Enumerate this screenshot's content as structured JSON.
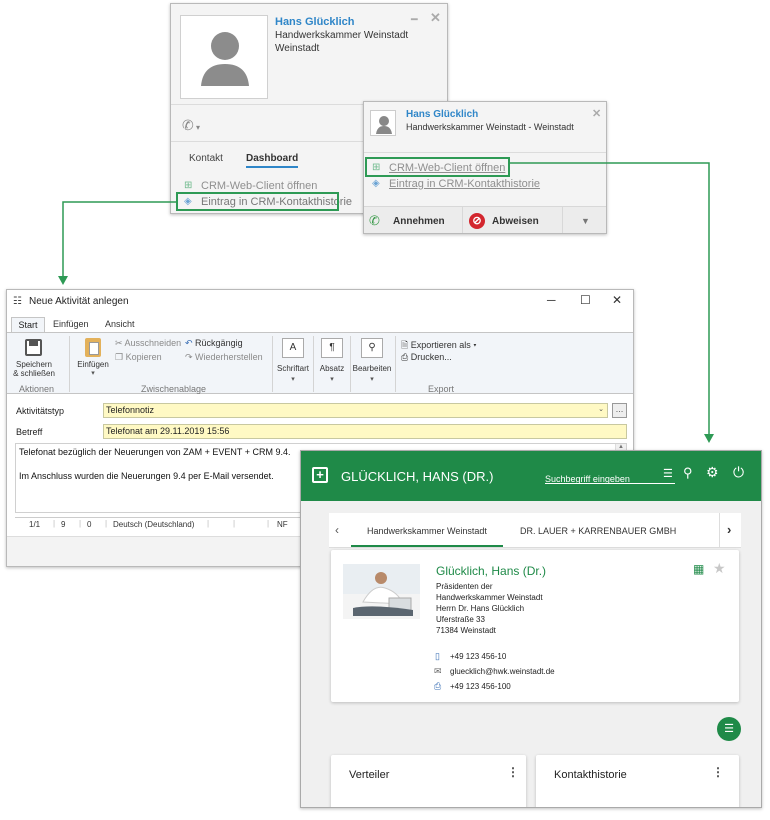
{
  "popup_large": {
    "name": "Hans Glücklich",
    "org": "Handwerkskammer Weinstadt",
    "city": "Weinstadt",
    "tabs": [
      "Kontakt",
      "Dashboard"
    ],
    "link_webclient": "CRM-Web-Client öffnen",
    "link_history": "Eintrag in CRM-Kontakthistorie"
  },
  "popup_small": {
    "name": "Hans Glücklich",
    "org_city": "Handwerkskammer Weinstadt - Weinstadt",
    "link_webclient": "CRM-Web-Client öffnen",
    "link_history": "Eintrag in CRM-Kontakthistorie",
    "accept_label": "Annehmen",
    "reject_label": "Abweisen"
  },
  "activity_window": {
    "title": "Neue Aktivität anlegen",
    "tabs": [
      "Start",
      "Einfügen",
      "Ansicht"
    ],
    "ribbon": {
      "save_label_1": "Speichern",
      "save_label_2": "& schließen",
      "group_actions": "Aktionen",
      "paste_label": "Einfügen",
      "cut_label": "Ausschneiden",
      "copy_label": "Kopieren",
      "undo_label": "Rückgängig",
      "redo_label": "Wiederherstellen",
      "group_clipboard": "Zwischenablage",
      "font_label": "Schriftart",
      "paragraph_label": "Absatz",
      "edit_label": "Bearbeiten",
      "export_label": "Exportieren als",
      "print_label": "Drucken...",
      "group_export": "Export"
    },
    "fields": {
      "type_label": "Aktivitätstyp",
      "type_value": "Telefonnotiz",
      "subject_label": "Betreff",
      "subject_value": "Telefonat am 29.11.2019 15:56"
    },
    "body_line1": "Telefonat bezüglich der Neuerungen von ZAM + EVENT + CRM 9.4.",
    "body_line2": "Im Anschluss wurden die Neuerungen 9.4 per E-Mail versendet.",
    "status": {
      "page": "1/1",
      "num1": "9",
      "num2": "0",
      "language": "Deutsch (Deutschland)",
      "nf": "NF"
    }
  },
  "webclient": {
    "header_title": "GLÜCKLICH, HANS (DR.)",
    "search_placeholder": "Suchbegriff eingeben",
    "tabs": [
      "Handwerkskammer Weinstadt",
      "DR. LAUER + KARRENBAUER GMBH"
    ],
    "contact": {
      "name": "Glücklich, Hans (Dr.)",
      "line1": "Präsidenten der",
      "line2": "Handwerkskammer Weinstadt",
      "line3": "Herrn Dr. Hans Glücklich",
      "line4": "Uferstraße 33",
      "line5": "71384 Weinstadt",
      "phone": "+49 123 456-10",
      "email": "gluecklich@hwk.weinstadt.de",
      "fax": "+49 123 456-100"
    },
    "card_distributor": "Verteiler",
    "card_history": "Kontakthistorie"
  },
  "colors": {
    "green": "#1f8a48",
    "highlight": "#2e9a55",
    "link_blue": "#2f86c8"
  }
}
